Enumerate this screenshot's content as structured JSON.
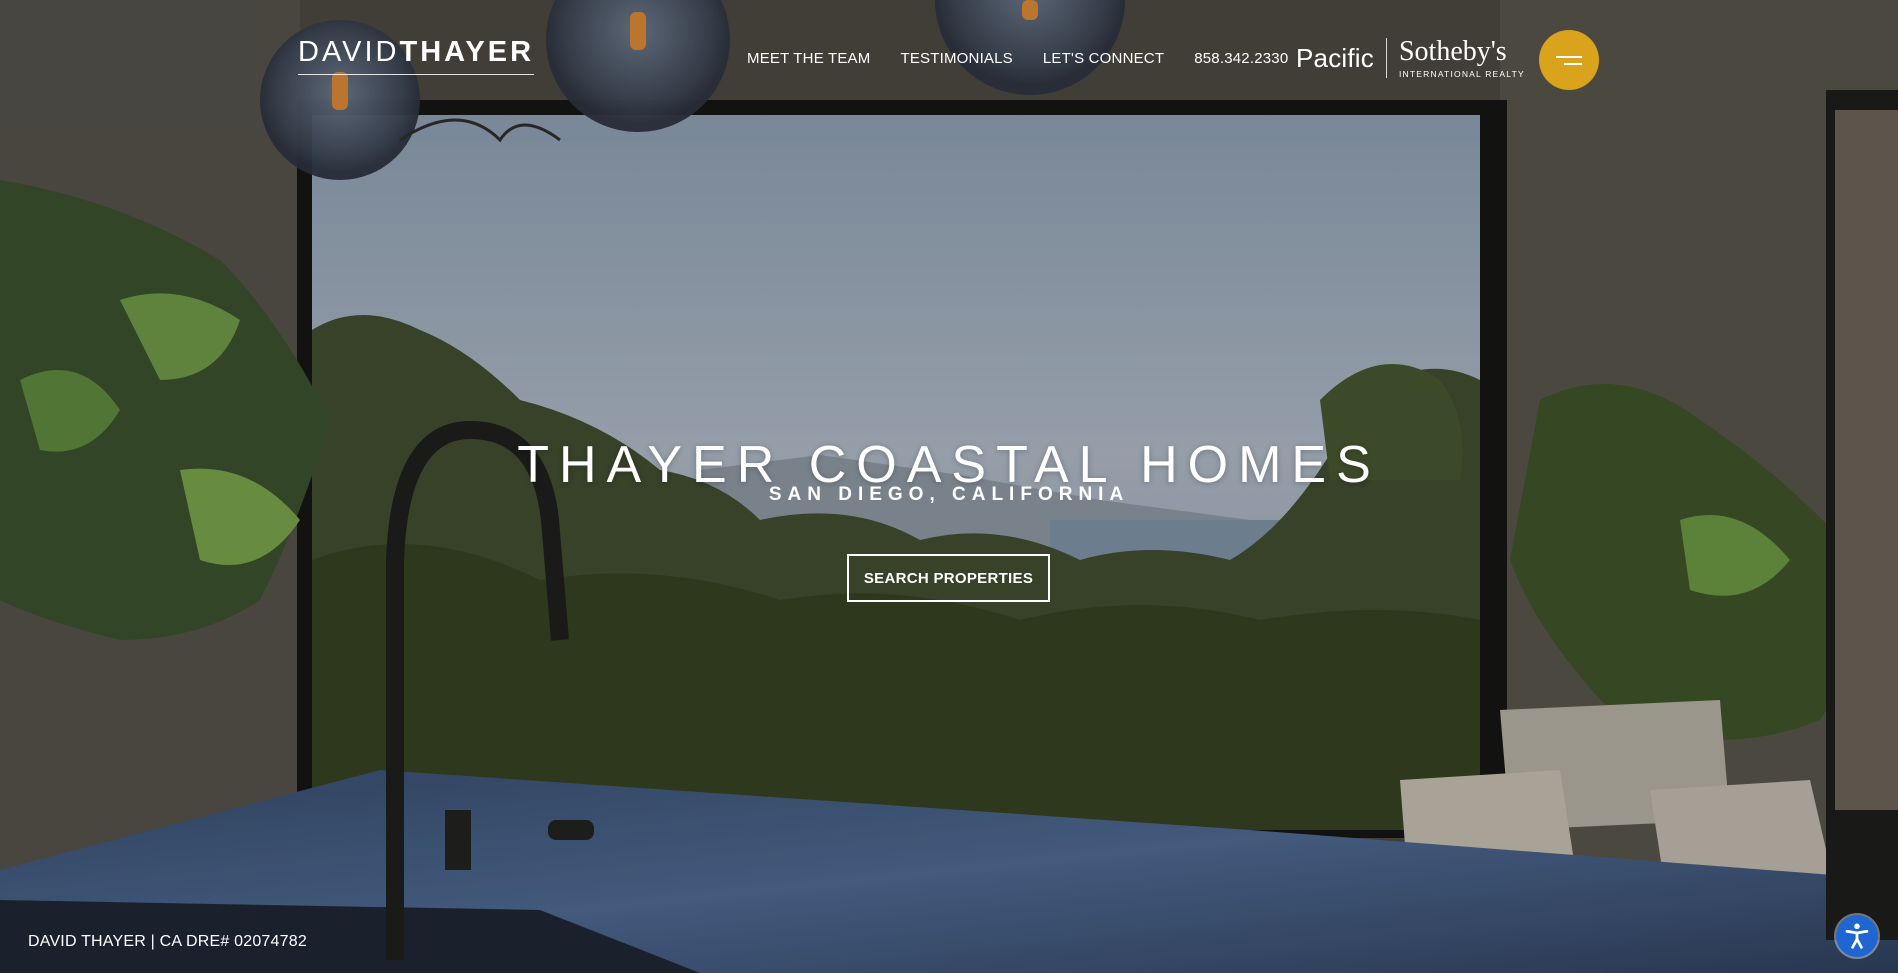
{
  "header": {
    "logo": {
      "first": "DAVID",
      "last": "THAYER"
    },
    "nav": [
      {
        "label": "MEET THE TEAM"
      },
      {
        "label": "TESTIMONIALS"
      },
      {
        "label": "LET'S CONNECT"
      },
      {
        "label": "858.342.2330"
      }
    ],
    "brokerage": {
      "pacific": "Pacific",
      "name": "Sotheby's",
      "tagline": "INTERNATIONAL REALTY"
    },
    "menu_icon": "hamburger-icon",
    "accent_color": "#d9a31c"
  },
  "hero": {
    "title": "THAYER COASTAL HOMES",
    "subtitle": "SAN DIEGO, CALIFORNIA",
    "cta_label": "SEARCH PROPERTIES"
  },
  "footer": {
    "license": "DAVID THAYER | CA DRE# 02074782"
  },
  "accessibility": {
    "icon": "accessibility-icon",
    "color": "#1f66d2"
  }
}
